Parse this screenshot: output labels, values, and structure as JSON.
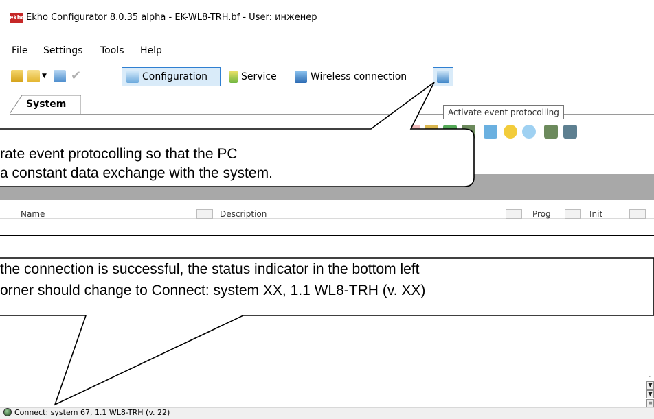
{
  "window": {
    "app_icon_text": "ekho",
    "title": "Ekho Configurator 8.0.35 alpha - EK-WL8-TRH.bf - User: инженер"
  },
  "menu": {
    "file": "File",
    "settings": "Settings",
    "tools": "Tools",
    "help": "Help"
  },
  "toolbar": {
    "configuration_label": "Configuration",
    "service_label": "Service",
    "wireless_label": "Wireless connection"
  },
  "tabs": {
    "system_label": "System"
  },
  "tooltip": {
    "text": "Activate event protocolling"
  },
  "columns": {
    "name": "Name",
    "description": "Description",
    "prog": "Prog",
    "init": "Init"
  },
  "callout_top": {
    "line1": "rate event protocolling so that the PC",
    "line2": "a constant data exchange with the system."
  },
  "callout_bottom": {
    "line1": "the connection is successful, the status indicator in the bottom left",
    "line2": "orner should change to Connect: system XX, 1.1 WL8-TRH (v. XX)"
  },
  "status": {
    "text": "Connect:  system 67, 1.1 WL8-TRH (v. 22)"
  },
  "colors": {
    "accent": "#2f7fd1",
    "grey_band": "#a8a8a8",
    "status_dot": "#3d6a3d"
  }
}
